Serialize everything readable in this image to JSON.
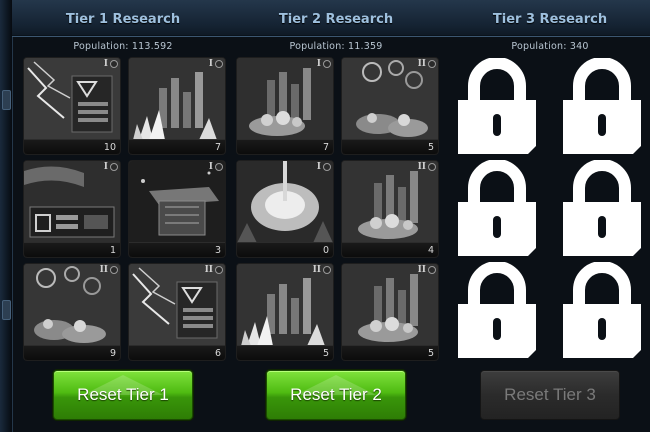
{
  "tiers": [
    {
      "title": "Tier 1 Research",
      "population": "Population: 113.592",
      "counts": [
        "10",
        "7",
        "1",
        "3",
        "9",
        "6"
      ],
      "tier_marks": [
        "I",
        "I",
        "I",
        "I",
        "II",
        "II"
      ],
      "locked": false,
      "reset_label": "Reset Tier 1",
      "reset_enabled": true
    },
    {
      "title": "Tier 2 Research",
      "population": "Population: 11.359",
      "counts": [
        "7",
        "5",
        "0",
        "4",
        "5",
        "5"
      ],
      "tier_marks": [
        "I",
        "II",
        "I",
        "II",
        "II",
        "II"
      ],
      "locked": false,
      "reset_label": "Reset Tier 2",
      "reset_enabled": true
    },
    {
      "title": "Tier 3 Research",
      "population": "Population: 340",
      "counts": [],
      "locked": true,
      "reset_label": "Reset Tier 3",
      "reset_enabled": false
    }
  ],
  "icons": {
    "lock": "padlock-icon",
    "tile_art": [
      "lightning-tech",
      "crystal-bars",
      "crystal-bars-flowers",
      "flowers-orbs",
      "pipe-console",
      "space-station",
      "explosion-blast",
      "bars-flowers",
      "orbs-flowers",
      "lightning-tech",
      "crystal-bars",
      "bars-flowers"
    ]
  },
  "colors": {
    "title_text": "#9ec0de",
    "reset_active": "#4fbb12",
    "reset_disabled": "#2b2b2b"
  }
}
